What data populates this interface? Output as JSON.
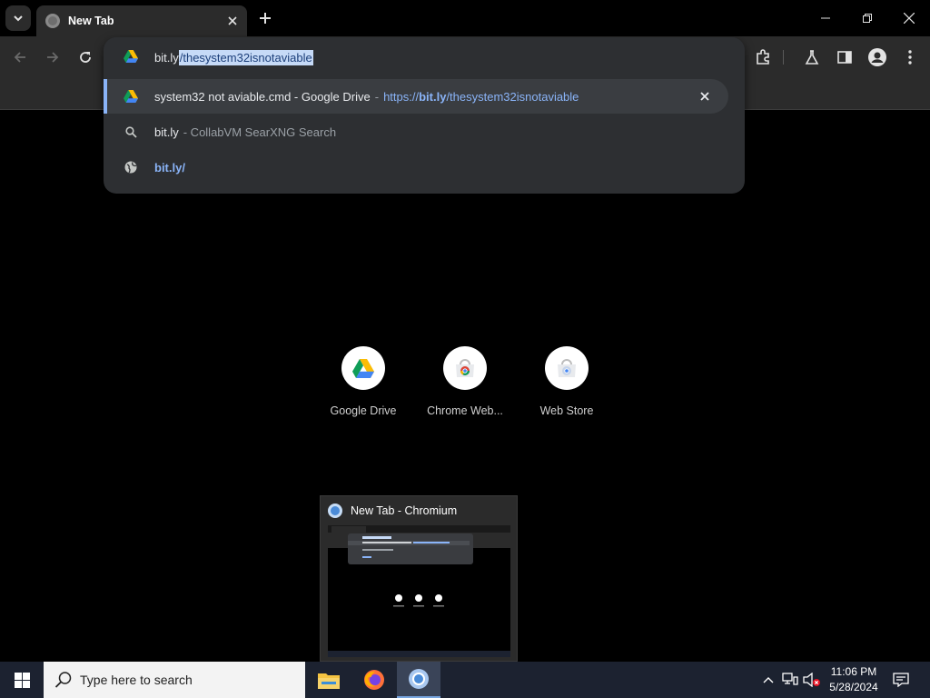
{
  "tab": {
    "title": "New Tab"
  },
  "omnibox": {
    "typed": "bit.ly",
    "autocomplete": "/thesystem32isnotaviable",
    "suggestions": [
      {
        "title": "system32 not aviable.cmd - Google Drive",
        "separator": "-",
        "url_prefix": "https://",
        "url_bold": "bit.ly",
        "url_suffix": "/thesystem32isnotaviable",
        "icon": "google-drive-icon"
      },
      {
        "query": "bit.ly",
        "source": "- CollabVM SearXNG Search",
        "icon": "search-icon"
      },
      {
        "url": "bit.ly/",
        "icon": "globe-icon"
      }
    ]
  },
  "shortcuts": [
    {
      "label": "Google Drive",
      "icon": "google-drive-icon"
    },
    {
      "label": "Chrome Web...",
      "icon": "chrome-web-store-icon"
    },
    {
      "label": "Web Store",
      "icon": "web-store-icon"
    }
  ],
  "preview": {
    "title": "New Tab - Chromium"
  },
  "taskbar": {
    "search_placeholder": "Type here to search",
    "time": "11:06 PM",
    "date": "5/28/2024"
  },
  "colors": {
    "accent": "#8ab4f8",
    "toolbar": "#2b2b2b",
    "omnibox_popup": "#2d2f32",
    "taskbar": "#1c2230"
  }
}
